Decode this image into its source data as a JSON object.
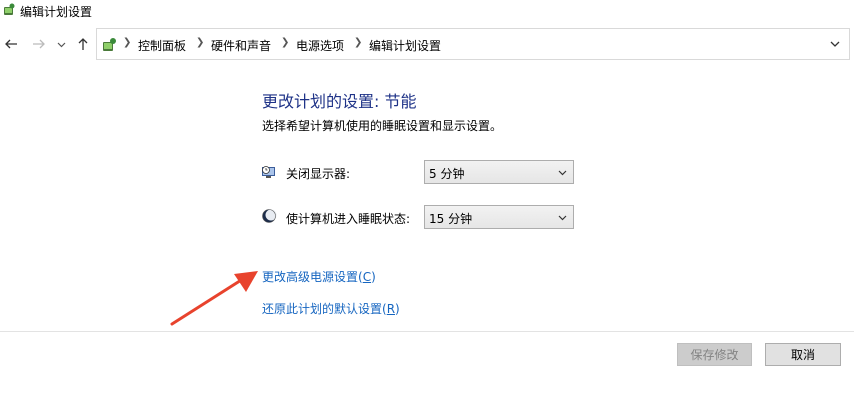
{
  "window": {
    "title": "编辑计划设置"
  },
  "navigation": {
    "back_icon": "back-arrow-icon",
    "forward_icon": "forward-arrow-icon",
    "recent_icon": "chevron-down-icon",
    "up_icon": "up-arrow-icon",
    "breadcrumbs": [
      "控制面板",
      "硬件和声音",
      "电源选项",
      "编辑计划设置"
    ],
    "address_dropdown_icon": "chevron-down-icon"
  },
  "main": {
    "heading": "更改计划的设置: 节能",
    "subheading": "选择希望计算机使用的睡眠设置和显示设置。",
    "settings": [
      {
        "label": "关闭显示器:",
        "value": "5 分钟",
        "icon": "monitor-clock-icon"
      },
      {
        "label": "使计算机进入睡眠状态:",
        "value": "15 分钟",
        "icon": "moon-icon"
      }
    ],
    "links": {
      "advanced": {
        "text": "更改高级电源设置(",
        "key": "C",
        "close": ")"
      },
      "restore": {
        "text": "还原此计划的默认设置(",
        "key": "R",
        "close": ")"
      }
    }
  },
  "footer": {
    "save_label": "保存修改",
    "cancel_label": "取消"
  },
  "colors": {
    "heading": "#1e3287",
    "link": "#1565c0",
    "annotation_arrow": "#e8432d"
  }
}
